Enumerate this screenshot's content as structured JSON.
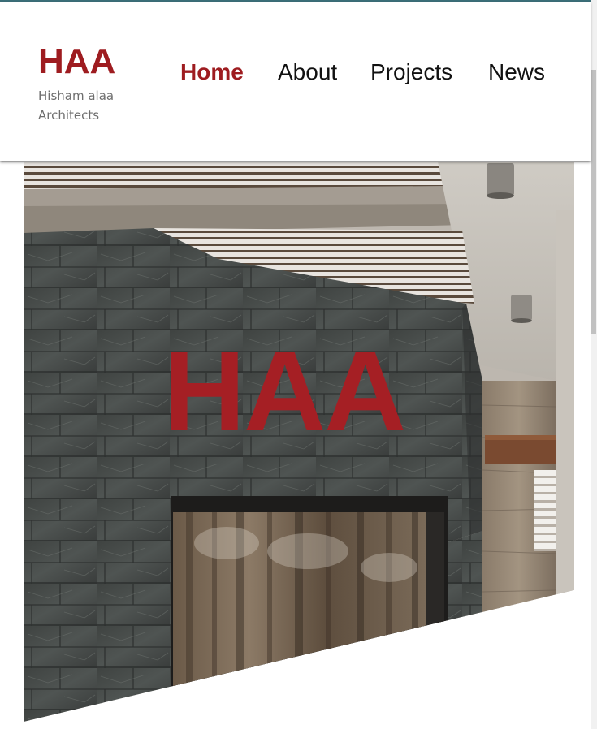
{
  "brand": {
    "title": "HAA",
    "subtitle": "Hisham alaa Architects"
  },
  "nav": {
    "items": [
      {
        "label": "Home",
        "active": true
      },
      {
        "label": "About",
        "active": false
      },
      {
        "label": "Projects",
        "active": false
      },
      {
        "label": "News",
        "active": false
      }
    ]
  },
  "hero": {
    "title": "HAA",
    "image": "architectural-facade-photo"
  },
  "colors": {
    "accent": "#9e1c20",
    "nav_text": "#111111",
    "subtitle_text": "#6e6e6e"
  }
}
